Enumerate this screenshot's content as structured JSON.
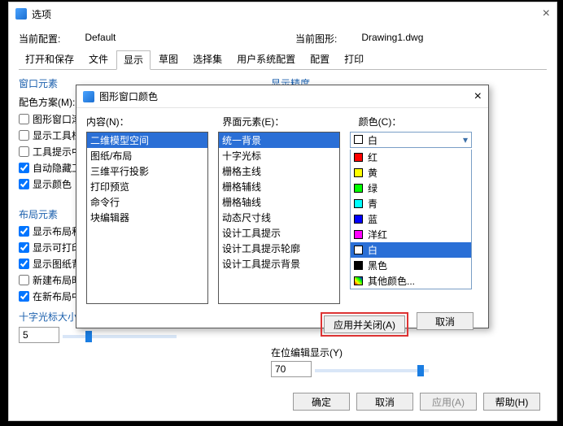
{
  "options_window": {
    "title": "选项",
    "close": "×",
    "cfg_label": "当前配置:",
    "cfg_value": "Default",
    "drawing_label": "当前图形:",
    "drawing_value": "Drawing1.dwg",
    "tabs": [
      "打开和保存",
      "文件",
      "显示",
      "草图",
      "选择集",
      "用户系统配置",
      "配置",
      "打印"
    ],
    "group_window_elem": "窗口元素",
    "color_scheme_label": "配色方案(M):",
    "chk_graphic_scroll": "图形窗口滚动条",
    "chk_show_toolbar": "显示工具栏大图标",
    "chk_tooltip": "工具提示中显示快捷键",
    "chk_autohide": "自动隐藏工具栏",
    "chk_showcolor": "显示颜色",
    "group_layout_elem": "布局元素",
    "chk_layout_tab": "显示布局和模型标签",
    "chk_print_area": "显示可打印区域",
    "chk_paper_bg": "显示图纸背景",
    "chk_new_layout": "新建布局时显示页面设置",
    "chk_in_new": "在新布局中创建视口",
    "group_precision": "显示精度",
    "group_cursor": "十字光标大小(R)",
    "cursor_val": "5",
    "inplace_label": "在位编辑显示(Y)",
    "inplace_val": "70",
    "btn_ok": "确定",
    "btn_cancel": "取消",
    "btn_apply": "应用(A)",
    "btn_help": "帮助(H)"
  },
  "color_dialog": {
    "title": "图形窗口颜色",
    "lbl_context": "内容(N)：",
    "lbl_interface": "界面元素(E)：",
    "lbl_color": "颜色(C)：",
    "contexts": [
      "二维模型空间",
      "图纸/布局",
      "三维平行投影",
      "打印预览",
      "命令行",
      "块编辑器"
    ],
    "interface_el": [
      "统一背景",
      "十字光标",
      "栅格主线",
      "栅格辅线",
      "栅格轴线",
      "动态尺寸线",
      "设计工具提示",
      "设计工具提示轮廓",
      "设计工具提示背景"
    ],
    "sel_color_label": "白",
    "colors": [
      {
        "name": "红",
        "hex": "#ff0000"
      },
      {
        "name": "黄",
        "hex": "#ffff00"
      },
      {
        "name": "绿",
        "hex": "#00ff00"
      },
      {
        "name": "青",
        "hex": "#00ffff"
      },
      {
        "name": "蓝",
        "hex": "#0000ff"
      },
      {
        "name": "洋红",
        "hex": "#ff00ff"
      },
      {
        "name": "白",
        "hex": "#ffffff"
      },
      {
        "name": "黑色",
        "hex": "#000000"
      }
    ],
    "other_colors": "其他颜色...",
    "other_swatch": "linear-gradient(45deg,#f00,#0f0,#00f)",
    "btn_apply_close": "应用并关闭(A)",
    "btn_cancel": "取消"
  }
}
